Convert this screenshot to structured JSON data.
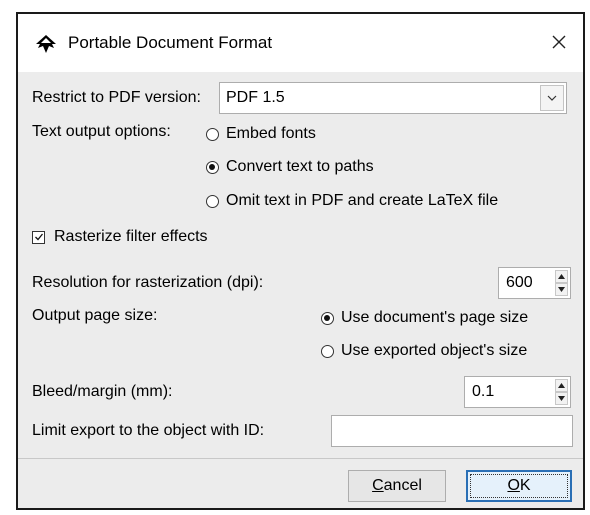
{
  "window": {
    "title": "Portable Document Format",
    "app_icon": "inkscape-icon",
    "close_icon": "close-icon"
  },
  "pdf_version": {
    "label": "Restrict to PDF version:",
    "value": "PDF 1.5",
    "dropdown_icon": "chevron-down-icon"
  },
  "text_output": {
    "label": "Text output options:",
    "options": [
      {
        "label": "Embed fonts",
        "checked": false
      },
      {
        "label": "Convert text to paths",
        "checked": true
      },
      {
        "label": "Omit text in PDF and create LaTeX file",
        "checked": false
      }
    ]
  },
  "rasterize": {
    "label": "Rasterize filter effects",
    "checked": true
  },
  "resolution": {
    "label": "Resolution for rasterization (dpi):",
    "value": "600"
  },
  "page_size": {
    "label": "Output page size:",
    "options": [
      {
        "label": "Use document's page size",
        "checked": true
      },
      {
        "label": "Use exported object's size",
        "checked": false
      }
    ]
  },
  "bleed": {
    "label": "Bleed/margin (mm):",
    "value": "0.1"
  },
  "limit_export": {
    "label": "Limit export to the object with ID:",
    "value": ""
  },
  "buttons": {
    "cancel_mnemonic": "C",
    "cancel_rest": "ancel",
    "ok_mnemonic": "O",
    "ok_rest": "K"
  }
}
